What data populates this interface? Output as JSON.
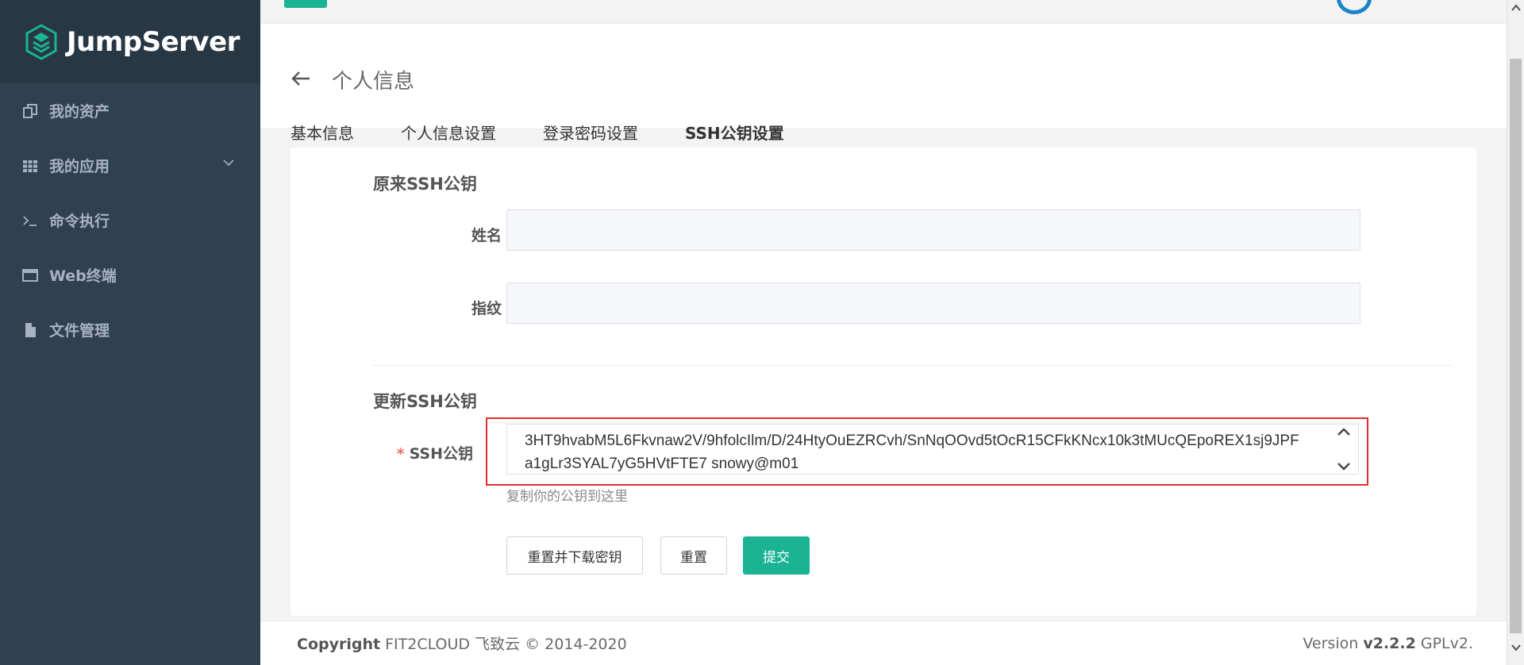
{
  "app": {
    "name": "JumpServer"
  },
  "sidebar": {
    "items": [
      {
        "label": "我的资产",
        "icon": "assets-icon"
      },
      {
        "label": "我的应用",
        "icon": "apps-grid-icon",
        "expandable": true
      },
      {
        "label": "命令执行",
        "icon": "terminal-prompt-icon"
      },
      {
        "label": "Web终端",
        "icon": "window-icon"
      },
      {
        "label": "文件管理",
        "icon": "file-icon"
      }
    ]
  },
  "header": {
    "title": "个人信息",
    "tabs": [
      {
        "label": "基本信息"
      },
      {
        "label": "个人信息设置"
      },
      {
        "label": "登录密码设置"
      },
      {
        "label": "SSH公钥设置",
        "active": true
      }
    ]
  },
  "form": {
    "original_section": "原来SSH公钥",
    "name_label": "姓名",
    "name_value": "",
    "fingerprint_label": "指纹",
    "fingerprint_value": "",
    "update_section": "更新SSH公钥",
    "ssh_label": "SSH公钥",
    "ssh_value_line1": "3HT9hvabM5L6Fkvnaw2V/9hfolcIlm/D/24HtyOuEZRCvh/SnNqOOvd5tOcR15CFkKNcx10k3tMUcQEpoREX1sj9JPF",
    "ssh_value_line2": "a1gLr3SYAL7yG5HVtFTE7 snowy@m01",
    "ssh_hint": "复制你的公钥到这里",
    "buttons": {
      "reset_download": "重置并下载密钥",
      "reset": "重置",
      "submit": "提交"
    }
  },
  "footer": {
    "copyright_label": "Copyright",
    "copyright_text": "FIT2CLOUD 飞致云 © 2014-2020",
    "version_label": "Version",
    "version_number": "v2.2.2",
    "license": "GPLv2."
  },
  "colors": {
    "sidebar_bg": "#2f4050",
    "accent": "#1ab394",
    "highlight_border": "#e52b2b"
  }
}
